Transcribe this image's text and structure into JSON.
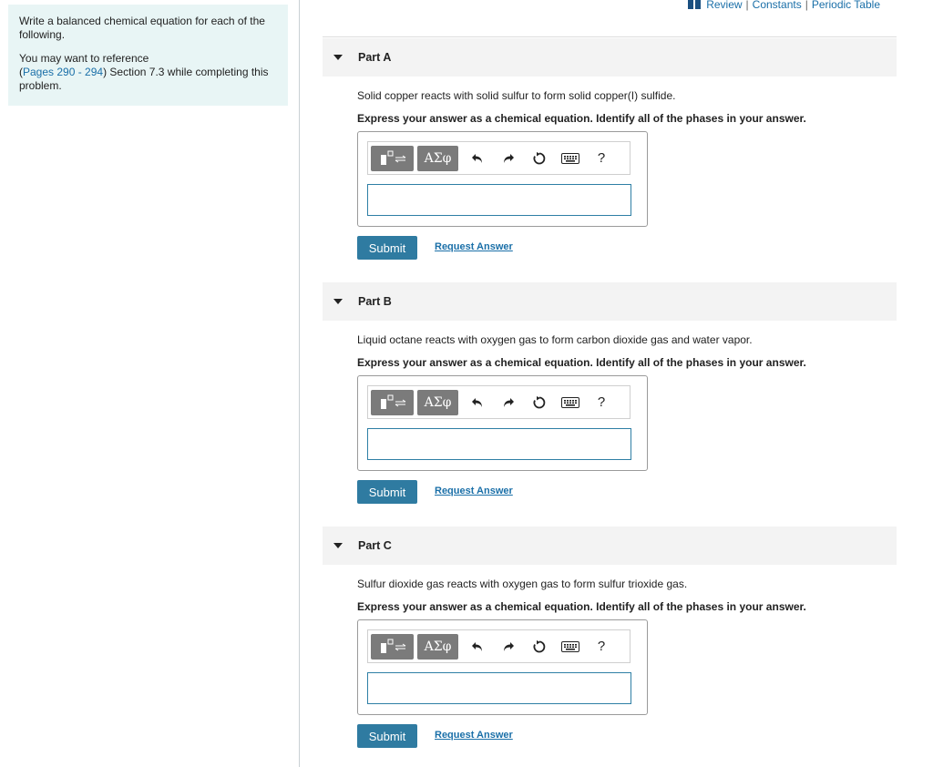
{
  "intro": {
    "text": "Write a balanced chemical equation for each of the following.",
    "reference_prefix": "You may want to reference",
    "reference_link": "Pages 290 - 294",
    "reference_suffix": "Section 7.3 while completing this problem."
  },
  "top_links": {
    "review": "Review",
    "constants": "Constants",
    "periodic_table": "Periodic Table",
    "separator": "|"
  },
  "toolbar": {
    "greek_label": "ΑΣφ",
    "help_label": "?"
  },
  "parts": [
    {
      "title": "Part A",
      "prompt": "Solid copper reacts with solid sulfur to form solid copper(I) sulfide.",
      "instruction": "Express your answer as a chemical equation. Identify all of the phases in your answer.",
      "answer": "",
      "submit_label": "Submit",
      "request_label": "Request Answer"
    },
    {
      "title": "Part B",
      "prompt": "Liquid octane reacts with oxygen gas to form carbon dioxide gas and water vapor.",
      "instruction": "Express your answer as a chemical equation. Identify all of the phases in your answer.",
      "answer": "",
      "submit_label": "Submit",
      "request_label": "Request Answer"
    },
    {
      "title": "Part C",
      "prompt": "Sulfur dioxide gas reacts with oxygen gas to form sulfur trioxide gas.",
      "instruction": "Express your answer as a chemical equation. Identify all of the phases in your answer.",
      "answer": "",
      "submit_label": "Submit",
      "request_label": "Request Answer"
    }
  ],
  "colors": {
    "accent": "#2f7ba1",
    "link": "#1a6fa8",
    "intro_bg": "#e8f5f5",
    "header_bg": "#f3f3f3"
  }
}
